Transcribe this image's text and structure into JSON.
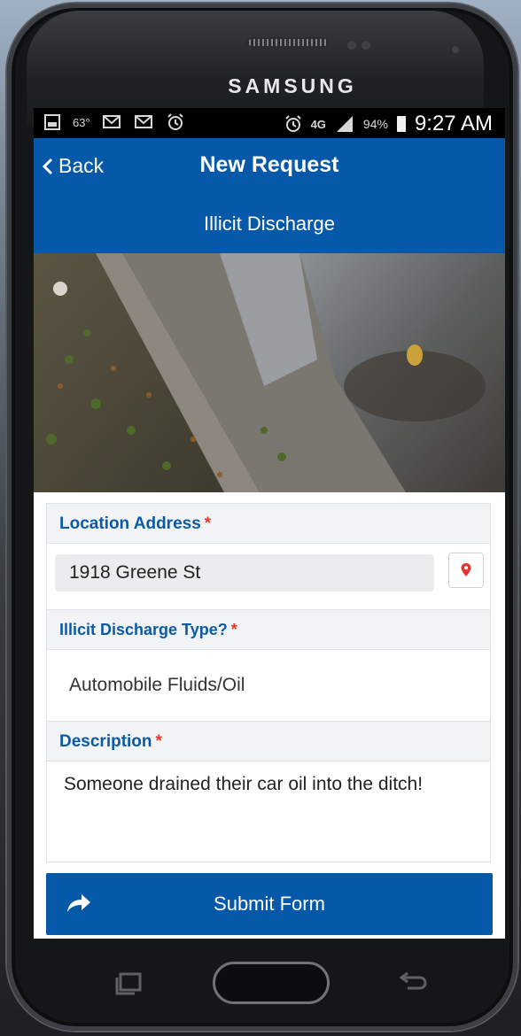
{
  "device": {
    "brand": "SAMSUNG"
  },
  "status_bar": {
    "temperature": "63°",
    "network": "4G",
    "battery": "94%",
    "time": "9:27 AM",
    "icons": [
      "screenshot-icon",
      "email-icon",
      "email-icon",
      "alarm-icon",
      "alarm-icon",
      "signal-icon",
      "battery-icon"
    ]
  },
  "header": {
    "back_label": "Back",
    "title": "New Request",
    "subtitle": "Illicit Discharge",
    "color": "#0659a8"
  },
  "form": {
    "location": {
      "label": "Location Address",
      "required_mark": "*",
      "value": "1918 Greene St"
    },
    "discharge_type": {
      "label": "Illicit Discharge Type?",
      "required_mark": "*",
      "value": "Automobile Fluids/Oil"
    },
    "description": {
      "label": "Description",
      "required_mark": "*",
      "value": "Someone drained their car oil into the ditch!"
    },
    "submit_label": "Submit Form"
  },
  "colors": {
    "accent": "#0659a8",
    "label": "#0b5aa6",
    "required": "#e4372c"
  }
}
